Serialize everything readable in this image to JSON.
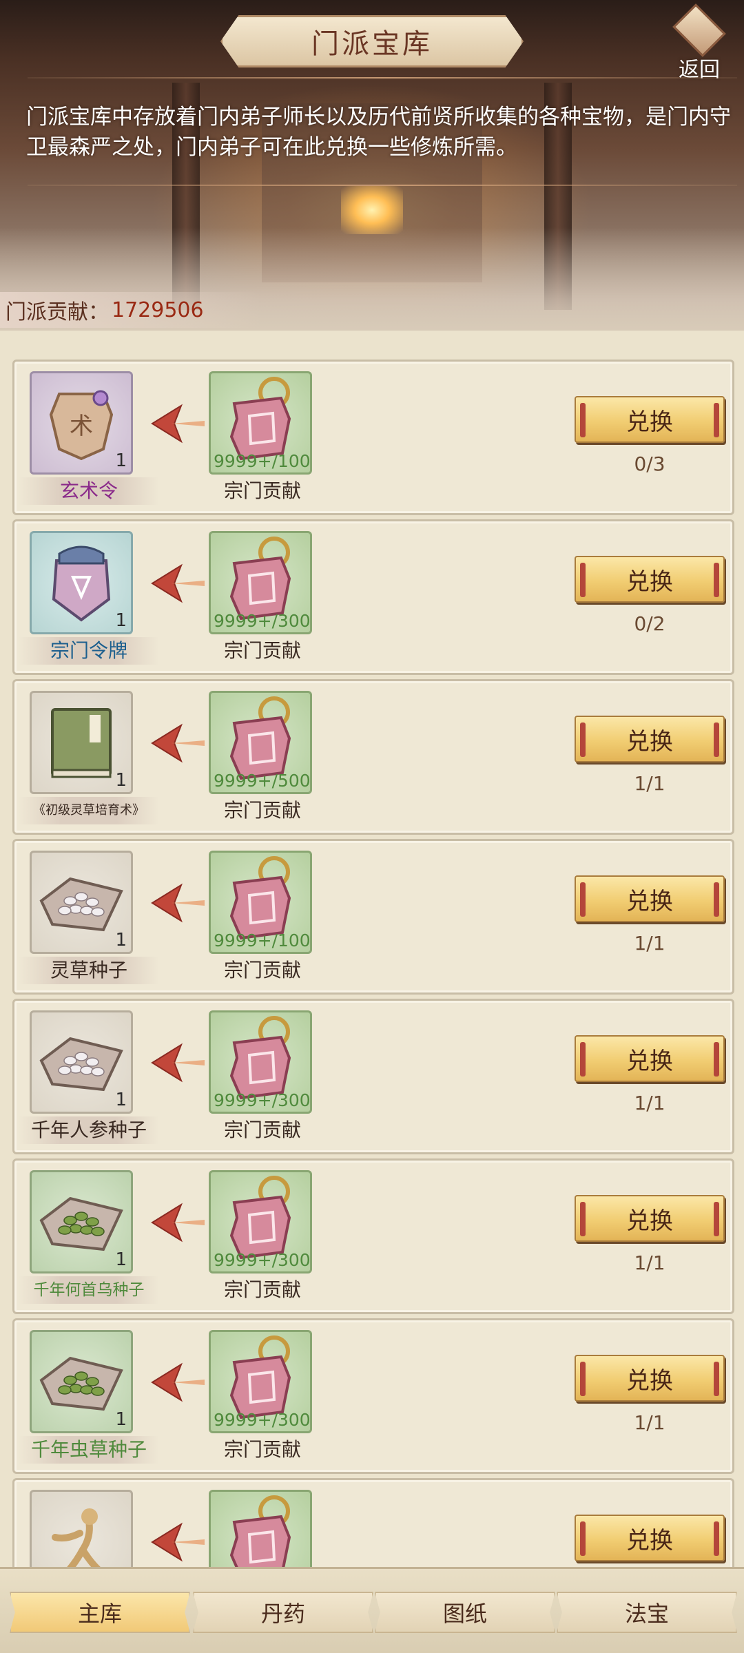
{
  "header": {
    "title": "门派宝库",
    "back_label": "返回",
    "description": "门派宝库中存放着门内弟子师长以及历代前贤所收集的各种宝物，是门内守卫最森严之处，门内弟子可在此兑换一些修炼所需。",
    "contribution_label": "门派贡献：",
    "contribution_value": "1729506"
  },
  "colors": {
    "accent_gold": "#f1cd72",
    "contribution_value": "#9a2a14",
    "cost_qty_green": "#4f8a3c"
  },
  "rows": [
    {
      "item_name": "玄术令",
      "item_name_color": "#8a2a8a",
      "item_icon": "jade-token-icon",
      "item_qty": "1",
      "cost_name": "宗门贡献",
      "cost_icon": "sect-plaque-icon",
      "cost_qty": "9999+/100",
      "button": "兑换",
      "limit": "0/3"
    },
    {
      "item_name": "宗门令牌",
      "item_name_color": "#1c5f8e",
      "item_icon": "sect-badge-icon",
      "item_qty": "1",
      "cost_name": "宗门贡献",
      "cost_icon": "sect-plaque-icon",
      "cost_qty": "9999+/300",
      "button": "兑换",
      "limit": "0/2"
    },
    {
      "item_name": "《初级灵草培育术》",
      "item_name_color": "#3a2a22",
      "item_icon": "book-icon",
      "item_qty": "1",
      "cost_name": "宗门贡献",
      "cost_icon": "sect-plaque-icon",
      "cost_qty": "9999+/500",
      "button": "兑换",
      "limit": "1/1"
    },
    {
      "item_name": "灵草种子",
      "item_name_color": "#3a2a22",
      "item_icon": "seed-pack-icon",
      "item_qty": "1",
      "cost_name": "宗门贡献",
      "cost_icon": "sect-plaque-icon",
      "cost_qty": "9999+/100",
      "button": "兑换",
      "limit": "1/1"
    },
    {
      "item_name": "千年人参种子",
      "item_name_color": "#3a2a22",
      "item_icon": "seed-pack-icon",
      "item_qty": "1",
      "cost_name": "宗门贡献",
      "cost_icon": "sect-plaque-icon",
      "cost_qty": "9999+/300",
      "button": "兑换",
      "limit": "1/1"
    },
    {
      "item_name": "千年何首乌种子",
      "item_name_color": "#4f8a3c",
      "item_icon": "green-seed-pack-icon",
      "item_qty": "1",
      "cost_name": "宗门贡献",
      "cost_icon": "sect-plaque-icon",
      "cost_qty": "9999+/300",
      "button": "兑换",
      "limit": "1/1"
    },
    {
      "item_name": "千年虫草种子",
      "item_name_color": "#4f8a3c",
      "item_icon": "green-seed-pack-icon",
      "item_qty": "1",
      "cost_name": "宗门贡献",
      "cost_icon": "sect-plaque-icon",
      "cost_qty": "9999+/300",
      "button": "兑换",
      "limit": "1/1"
    },
    {
      "item_name": "",
      "item_name_color": "#3a2a22",
      "item_icon": "ginseng-root-icon",
      "item_qty": "",
      "cost_name": "",
      "cost_icon": "sect-plaque-icon",
      "cost_qty": "",
      "button": "兑换",
      "limit": ""
    }
  ],
  "tabs": [
    {
      "label": "主库",
      "active": true
    },
    {
      "label": "丹药",
      "active": false
    },
    {
      "label": "图纸",
      "active": false
    },
    {
      "label": "法宝",
      "active": false
    }
  ]
}
